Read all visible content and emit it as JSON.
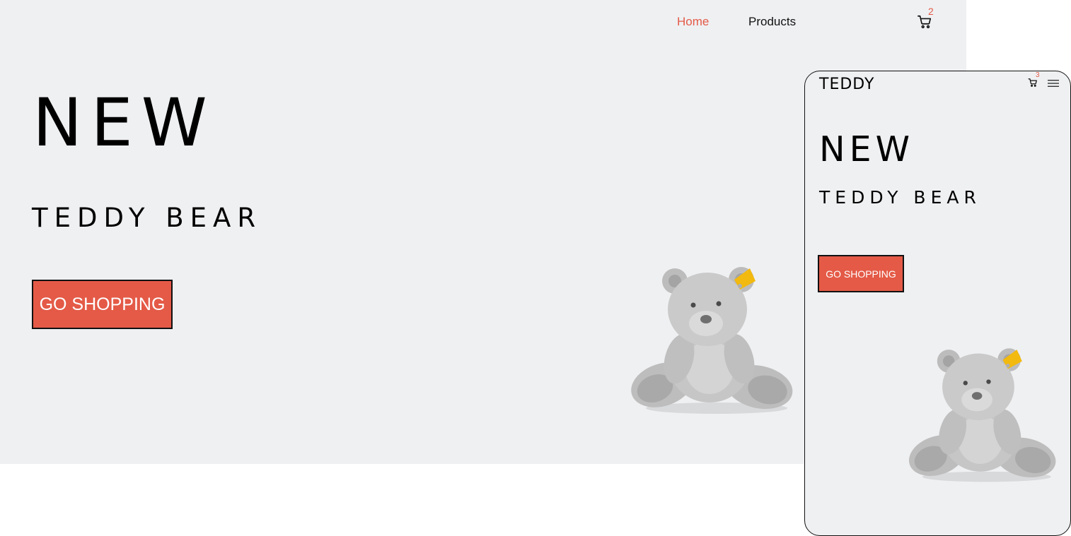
{
  "desktop": {
    "nav": {
      "home": "Home",
      "products": "Products"
    },
    "cart": {
      "count": "2",
      "icon": "cart-icon"
    },
    "hero": {
      "title": "NEW",
      "subtitle": "TEDDY BEAR",
      "cta": "GO SHOPPING"
    }
  },
  "mobile": {
    "logo": "TEDDY",
    "cart": {
      "count": "3",
      "icon": "cart-icon"
    },
    "menu_icon": "hamburger-menu-icon",
    "hero": {
      "title": "NEW",
      "subtitle": "TEDDY BEAR",
      "cta": "GO SHOPPING"
    }
  },
  "colors": {
    "background": "#eff0f2",
    "accent": "#e45a47",
    "text": "#000000",
    "bear_fur": "#c5c5c5"
  }
}
